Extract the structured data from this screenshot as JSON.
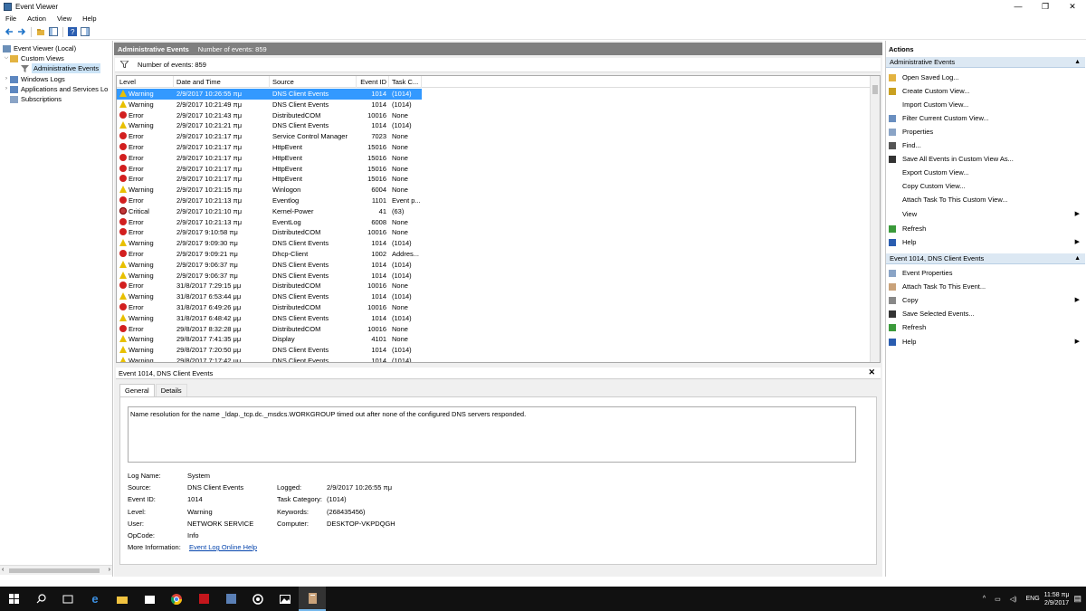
{
  "window": {
    "title": "Event Viewer",
    "minimize": "—",
    "restore": "❐",
    "close": "✕"
  },
  "menu": [
    "File",
    "Action",
    "View",
    "Help"
  ],
  "tree": {
    "root": "Event Viewer (Local)",
    "custom_views": "Custom Views",
    "admin_events": "Administrative Events",
    "windows_logs": "Windows Logs",
    "apps_services": "Applications and Services Lo",
    "subscriptions": "Subscriptions"
  },
  "center": {
    "header_title": "Administrative Events",
    "header_count": "Number of events: 859",
    "filter_count": "Number of events: 859"
  },
  "grid": {
    "columns": [
      "Level",
      "Date and Time",
      "Source",
      "Event ID",
      "Task C..."
    ],
    "rows": [
      {
        "level": "Warning",
        "type": "warn",
        "date": "2/9/2017 10:26:55 πμ",
        "source": "DNS Client Events",
        "id": "1014",
        "task": "(1014)"
      },
      {
        "level": "Warning",
        "type": "warn",
        "date": "2/9/2017 10:21:49 πμ",
        "source": "DNS Client Events",
        "id": "1014",
        "task": "(1014)"
      },
      {
        "level": "Error",
        "type": "err",
        "date": "2/9/2017 10:21:43 πμ",
        "source": "DistributedCOM",
        "id": "10016",
        "task": "None"
      },
      {
        "level": "Warning",
        "type": "warn",
        "date": "2/9/2017 10:21:21 πμ",
        "source": "DNS Client Events",
        "id": "1014",
        "task": "(1014)"
      },
      {
        "level": "Error",
        "type": "err",
        "date": "2/9/2017 10:21:17 πμ",
        "source": "Service Control Manager",
        "id": "7023",
        "task": "None"
      },
      {
        "level": "Error",
        "type": "err",
        "date": "2/9/2017 10:21:17 πμ",
        "source": "HttpEvent",
        "id": "15016",
        "task": "None"
      },
      {
        "level": "Error",
        "type": "err",
        "date": "2/9/2017 10:21:17 πμ",
        "source": "HttpEvent",
        "id": "15016",
        "task": "None"
      },
      {
        "level": "Error",
        "type": "err",
        "date": "2/9/2017 10:21:17 πμ",
        "source": "HttpEvent",
        "id": "15016",
        "task": "None"
      },
      {
        "level": "Error",
        "type": "err",
        "date": "2/9/2017 10:21:17 πμ",
        "source": "HttpEvent",
        "id": "15016",
        "task": "None"
      },
      {
        "level": "Warning",
        "type": "warn",
        "date": "2/9/2017 10:21:15 πμ",
        "source": "Winlogon",
        "id": "6004",
        "task": "None"
      },
      {
        "level": "Error",
        "type": "err",
        "date": "2/9/2017 10:21:13 πμ",
        "source": "Eventlog",
        "id": "1101",
        "task": "Event p..."
      },
      {
        "level": "Critical",
        "type": "crit",
        "date": "2/9/2017 10:21:10 πμ",
        "source": "Kernel-Power",
        "id": "41",
        "task": "(63)"
      },
      {
        "level": "Error",
        "type": "err",
        "date": "2/9/2017 10:21:13 πμ",
        "source": "EventLog",
        "id": "6008",
        "task": "None"
      },
      {
        "level": "Error",
        "type": "err",
        "date": "2/9/2017 9:10:58 πμ",
        "source": "DistributedCOM",
        "id": "10016",
        "task": "None"
      },
      {
        "level": "Warning",
        "type": "warn",
        "date": "2/9/2017 9:09:30 πμ",
        "source": "DNS Client Events",
        "id": "1014",
        "task": "(1014)"
      },
      {
        "level": "Error",
        "type": "err",
        "date": "2/9/2017 9:09:21 πμ",
        "source": "Dhcp-Client",
        "id": "1002",
        "task": "Addres..."
      },
      {
        "level": "Warning",
        "type": "warn",
        "date": "2/9/2017 9:06:37 πμ",
        "source": "DNS Client Events",
        "id": "1014",
        "task": "(1014)"
      },
      {
        "level": "Warning",
        "type": "warn",
        "date": "2/9/2017 9:06:37 πμ",
        "source": "DNS Client Events",
        "id": "1014",
        "task": "(1014)"
      },
      {
        "level": "Error",
        "type": "err",
        "date": "31/8/2017 7:29:15 μμ",
        "source": "DistributedCOM",
        "id": "10016",
        "task": "None"
      },
      {
        "level": "Warning",
        "type": "warn",
        "date": "31/8/2017 6:53:44 μμ",
        "source": "DNS Client Events",
        "id": "1014",
        "task": "(1014)"
      },
      {
        "level": "Error",
        "type": "err",
        "date": "31/8/2017 6:49:26 μμ",
        "source": "DistributedCOM",
        "id": "10016",
        "task": "None"
      },
      {
        "level": "Warning",
        "type": "warn",
        "date": "31/8/2017 6:48:42 μμ",
        "source": "DNS Client Events",
        "id": "1014",
        "task": "(1014)"
      },
      {
        "level": "Error",
        "type": "err",
        "date": "29/8/2017 8:32:28 μμ",
        "source": "DistributedCOM",
        "id": "10016",
        "task": "None"
      },
      {
        "level": "Warning",
        "type": "warn",
        "date": "29/8/2017 7:41:35 μμ",
        "source": "Display",
        "id": "4101",
        "task": "None"
      },
      {
        "level": "Warning",
        "type": "warn",
        "date": "29/8/2017 7:20:50 μμ",
        "source": "DNS Client Events",
        "id": "1014",
        "task": "(1014)"
      },
      {
        "level": "Warning",
        "type": "warn",
        "date": "29/8/2017 7:17:42 μμ",
        "source": "DNS Client Events",
        "id": "1014",
        "task": "(1014)"
      }
    ]
  },
  "detail": {
    "title": "Event 1014, DNS Client Events",
    "close": "✕",
    "tab_general": "General",
    "tab_details": "Details",
    "description": "Name resolution for the name _ldap._tcp.dc._msdcs.WORKGROUP timed out after none of the configured DNS servers responded.",
    "labels": {
      "log_name": "Log Name:",
      "source": "Source:",
      "event_id": "Event ID:",
      "level": "Level:",
      "user": "User:",
      "opcode": "OpCode:",
      "more_info": "More Information:",
      "logged": "Logged:",
      "task_category": "Task Category:",
      "keywords": "Keywords:",
      "computer": "Computer:"
    },
    "values": {
      "log_name": "System",
      "source": "DNS Client Events",
      "event_id": "1014",
      "level": "Warning",
      "user": "NETWORK SERVICE",
      "opcode": "Info",
      "more_info": "Event Log Online Help",
      "logged": "2/9/2017 10:26:55 πμ",
      "task_category": "(1014)",
      "keywords": "(268435456)",
      "computer": "DESKTOP-VKPDQGH"
    }
  },
  "actions": {
    "title": "Actions",
    "section1": "Administrative Events",
    "items1": [
      "Open Saved Log...",
      "Create Custom View...",
      "Import Custom View...",
      "Filter Current Custom View...",
      "Properties",
      "Find...",
      "Save All Events in Custom View As...",
      "Export Custom View...",
      "Copy Custom View...",
      "Attach Task To This Custom View...",
      "View",
      "Refresh",
      "Help"
    ],
    "section2": "Event 1014, DNS Client Events",
    "items2": [
      "Event Properties",
      "Attach Task To This Event...",
      "Copy",
      "Save Selected Events...",
      "Refresh",
      "Help"
    ]
  },
  "taskbar": {
    "tray_lang": "ENG",
    "time": "11:58 πμ",
    "date": "2/9/2017"
  },
  "colors": {
    "selection": "#3399ff",
    "header": "#7f7f7f",
    "action_section": "#dce8f3",
    "taskbar": "#111111"
  }
}
